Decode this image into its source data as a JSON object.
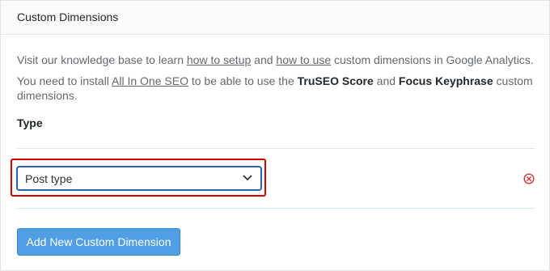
{
  "panel": {
    "title": "Custom Dimensions"
  },
  "description": {
    "line1_prefix": "Visit our knowledge base to learn ",
    "line1_link1": "how to setup",
    "line1_middle": " and ",
    "line1_link2": "how to use",
    "line1_suffix": " custom dimensions in Google Analytics.",
    "line2_prefix": "You need to install ",
    "line2_link": "All In One SEO",
    "line2_middle1": " to be able to use the ",
    "line2_bold1": "TruSEO Score",
    "line2_middle2": " and ",
    "line2_bold2": "Focus Keyphrase",
    "line2_suffix": " custom dimensions."
  },
  "type_section": {
    "label": "Type",
    "selected_value": "Post type",
    "dropdown_icon": "chevron-down-icon",
    "remove_icon": "remove-circle-x-icon"
  },
  "actions": {
    "add_label": "Add New Custom Dimension"
  },
  "colors": {
    "highlight": "#d40000",
    "remove_icon": "#d63638",
    "button_bg": "#509ee3",
    "select_border": "#1e5ea3"
  }
}
